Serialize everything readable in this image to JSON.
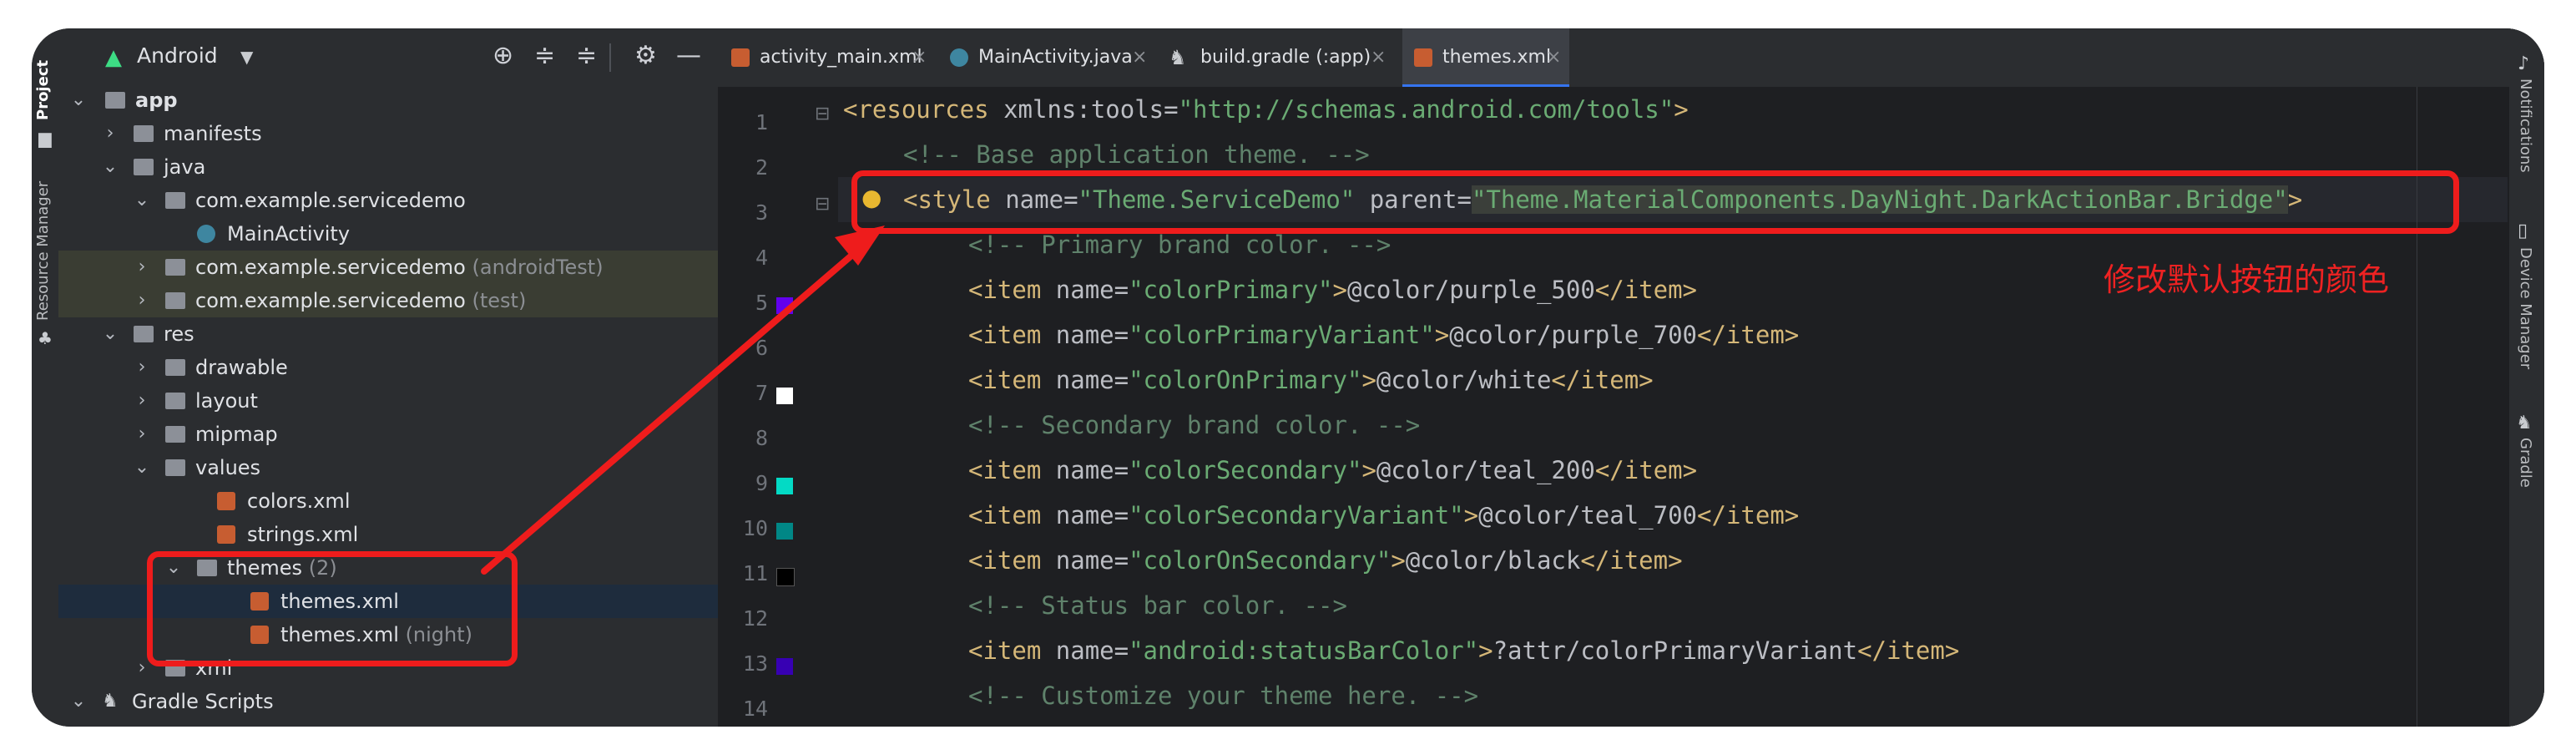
{
  "left_strip": {
    "project_label": "Project",
    "resource_manager_label": "Resource Manager"
  },
  "panel": {
    "title": "Android",
    "tree": [
      {
        "label": "app",
        "suffix": ""
      },
      {
        "label": "manifests",
        "suffix": ""
      },
      {
        "label": "java",
        "suffix": ""
      },
      {
        "label": "com.example.servicedemo",
        "suffix": ""
      },
      {
        "label": "MainActivity",
        "suffix": ""
      },
      {
        "label": "com.example.servicedemo",
        "suffix": "(androidTest)"
      },
      {
        "label": "com.example.servicedemo",
        "suffix": "(test)"
      },
      {
        "label": "res",
        "suffix": ""
      },
      {
        "label": "drawable",
        "suffix": ""
      },
      {
        "label": "layout",
        "suffix": ""
      },
      {
        "label": "mipmap",
        "suffix": ""
      },
      {
        "label": "values",
        "suffix": ""
      },
      {
        "label": "colors.xml",
        "suffix": ""
      },
      {
        "label": "strings.xml",
        "suffix": ""
      },
      {
        "label": "themes",
        "suffix": "(2)"
      },
      {
        "label": "themes.xml",
        "suffix": ""
      },
      {
        "label": "themes.xml",
        "suffix": "(night)"
      },
      {
        "label": "xml",
        "suffix": ""
      },
      {
        "label": "Gradle Scripts",
        "suffix": ""
      }
    ]
  },
  "tabs": [
    {
      "label": "activity_main.xml",
      "icon": "xml-file-icon"
    },
    {
      "label": "MainActivity.java",
      "icon": "java-class-icon"
    },
    {
      "label": "build.gradle (:app)",
      "icon": "gradle-icon"
    },
    {
      "label": "themes.xml",
      "icon": "xml-file-icon"
    }
  ],
  "close_glyph": "×",
  "line_numbers": [
    "1",
    "2",
    "3",
    "4",
    "5",
    "6",
    "7",
    "8",
    "9",
    "10",
    "11",
    "12",
    "13",
    "14"
  ],
  "code": {
    "l1": {
      "tag": "<resources",
      "attr": " xmlns:tools=",
      "val": "\"http://schemas.android.com/tools\"",
      "end": ">"
    },
    "l2": "<!-- Base application theme. -->",
    "l3": {
      "tag": "<style",
      "a1": " name=",
      "v1": "\"Theme.ServiceDemo\"",
      "a2": " parent=",
      "v2": "\"Theme.MaterialComponents.DayNight.DarkActionBar.Bridge\"",
      "end": ">"
    },
    "l4": "<!-- Primary brand color. -->",
    "l5": {
      "open": "<item",
      "attr": " name=",
      "val": "\"colorPrimary\"",
      "gt": ">",
      "text": "@color/purple_500",
      "close": "</item>"
    },
    "l6": {
      "open": "<item",
      "attr": " name=",
      "val": "\"colorPrimaryVariant\"",
      "gt": ">",
      "text": "@color/purple_700",
      "close": "</item>"
    },
    "l7": {
      "open": "<item",
      "attr": " name=",
      "val": "\"colorOnPrimary\"",
      "gt": ">",
      "text": "@color/white",
      "close": "</item>"
    },
    "l8": "<!-- Secondary brand color. -->",
    "l9": {
      "open": "<item",
      "attr": " name=",
      "val": "\"colorSecondary\"",
      "gt": ">",
      "text": "@color/teal_200",
      "close": "</item>"
    },
    "l10": {
      "open": "<item",
      "attr": " name=",
      "val": "\"colorSecondaryVariant\"",
      "gt": ">",
      "text": "@color/teal_700",
      "close": "</item>"
    },
    "l11": {
      "open": "<item",
      "attr": " name=",
      "val": "\"colorOnSecondary\"",
      "gt": ">",
      "text": "@color/black",
      "close": "</item>"
    },
    "l12": "<!-- Status bar color. -->",
    "l13": {
      "open": "<item",
      "attr": " name=",
      "val": "\"android:statusBarColor\"",
      "gt": ">",
      "text": "?attr/colorPrimaryVariant",
      "close": "</item>"
    },
    "l14": "<!-- Customize your theme here. -->"
  },
  "swatch_colors": {
    "l5": "#6200ee",
    "l7": "#ffffff",
    "l9": "#03dac5",
    "l10": "#018786",
    "l11": "#000000",
    "l13": "#3700b3"
  },
  "annotation_text": "修改默认按钮的颜色",
  "annotation_color": "#ee1c1c",
  "right_strip": {
    "notifications_label": "Notifications",
    "device_manager_label": "Device Manager",
    "gradle_label": "Gradle"
  }
}
